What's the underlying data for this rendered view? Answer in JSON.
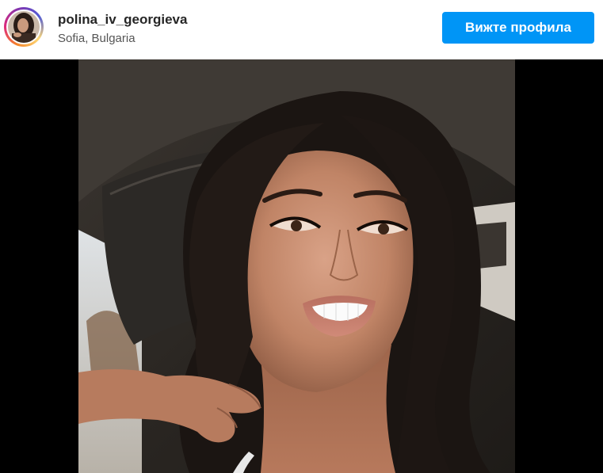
{
  "post": {
    "username": "polina_iv_georgieva",
    "location": "Sofia, Bulgaria",
    "view_profile_label": "Вижте профила"
  },
  "icons": {
    "avatar": "profile-photo",
    "photo": "selfie-photo"
  },
  "colors": {
    "button_bg": "#0095f6",
    "button_text": "#ffffff",
    "username": "#262626",
    "location": "#555555",
    "media_bg": "#000000"
  }
}
